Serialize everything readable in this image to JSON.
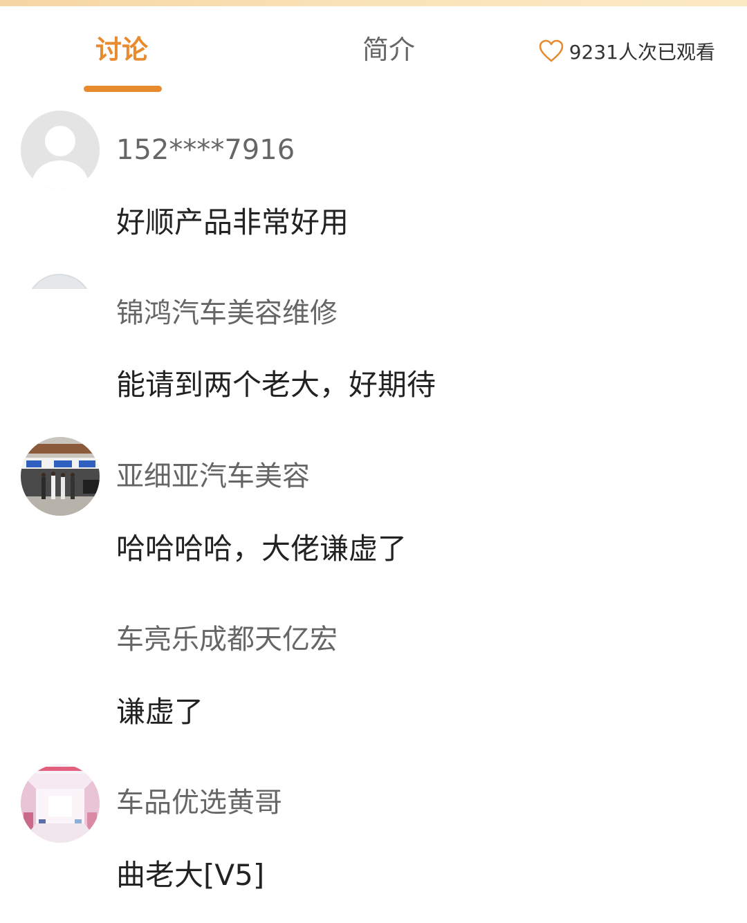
{
  "tabs": {
    "discussion": "讨论",
    "intro": "简介"
  },
  "view_count": {
    "text": "9231人次已观看",
    "icon": "heart-icon"
  },
  "comments": [
    {
      "username": "152****7916",
      "message": "好顺产品非常好用",
      "avatar": "default-user-avatar"
    },
    {
      "username": "锦鸿汽车美容维修",
      "message": "能请到两个老大，好期待",
      "avatar": "partially-hidden-avatar"
    },
    {
      "username": "亚细亚汽车美容",
      "message": "哈哈哈哈，大佬谦虚了",
      "avatar": "storefront-photo-avatar"
    },
    {
      "username": "车亮乐成都天亿宏",
      "message": "谦虚了",
      "avatar": "none"
    },
    {
      "username": "车品优选黄哥",
      "message": "曲老大[V5]",
      "avatar": "store-interior-avatar"
    }
  ],
  "colors": {
    "accent": "#e88a2e",
    "text_primary": "#222222",
    "text_secondary": "#666666",
    "top_strip": "#f9e3b8"
  }
}
